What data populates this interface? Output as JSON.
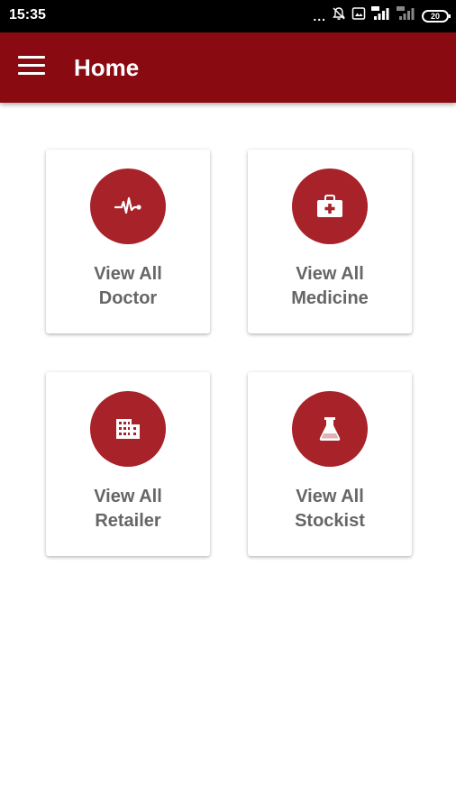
{
  "status_bar": {
    "time": "15:35",
    "more_indicator": "...",
    "battery_level": "20"
  },
  "app_bar": {
    "title": "Home",
    "background_color": "#8a0a12"
  },
  "cards": [
    {
      "line1": "View All",
      "line2": "Doctor",
      "icon": "heartbeat-icon"
    },
    {
      "line1": "View All",
      "line2": "Medicine",
      "icon": "medical-kit-icon"
    },
    {
      "line1": "View All",
      "line2": "Retailer",
      "icon": "building-icon"
    },
    {
      "line1": "View All",
      "line2": "Stockist",
      "icon": "flask-icon"
    }
  ],
  "colors": {
    "icon_circle": "#a72229",
    "card_label": "#666666"
  }
}
